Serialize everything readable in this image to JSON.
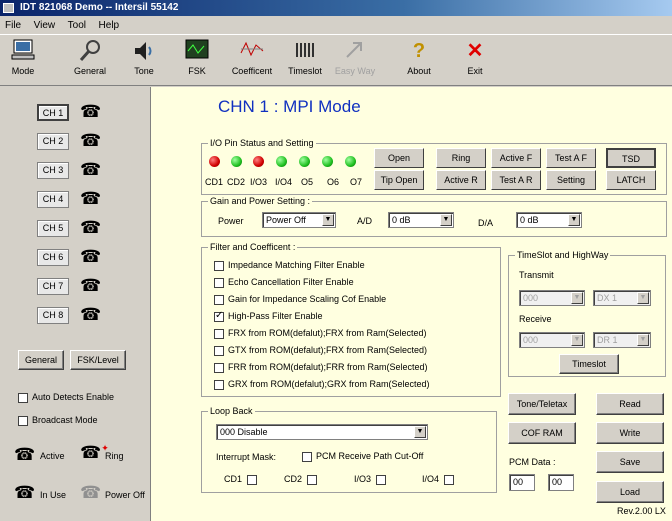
{
  "window": {
    "title": "IDT 821068 Demo -- Intersil 55142"
  },
  "menu": [
    "File",
    "View",
    "Tool",
    "Help"
  ],
  "toolbar": [
    {
      "label": "Mode",
      "icon": "computer-icon"
    },
    {
      "label": "General",
      "icon": "wrench-icon"
    },
    {
      "label": "Tone",
      "icon": "speaker-icon"
    },
    {
      "label": "FSK",
      "icon": "oscilloscope-icon"
    },
    {
      "label": "Coefficent",
      "icon": "waveform-icon"
    },
    {
      "label": "Timeslot",
      "icon": "timeslot-icon"
    },
    {
      "label": "Easy Way",
      "icon": "arrow-icon",
      "disabled": true
    },
    {
      "label": "About",
      "icon": "question-icon"
    },
    {
      "label": "Exit",
      "icon": "exit-x-icon"
    }
  ],
  "channels": [
    "CH 1",
    "CH 2",
    "CH 3",
    "CH 4",
    "CH 5",
    "CH 6",
    "CH 7",
    "CH 8"
  ],
  "left": {
    "general_button": "General",
    "fsk_button": "FSK/Level",
    "auto_detects": "Auto Detects Enable",
    "broadcast": "Broadcast Mode",
    "legend_active": "Active",
    "legend_ring": "Ring",
    "legend_inuse": "In Use",
    "legend_poweroff": "Power Off"
  },
  "main": {
    "title": "CHN 1 : MPI Mode",
    "io": {
      "group_title": "I/O Pin Status and Setting",
      "leds": [
        "red",
        "green",
        "red",
        "green",
        "green",
        "green",
        "green"
      ],
      "pins": [
        "CD1",
        "CD2",
        "I/O3",
        "I/O4",
        "O5",
        "O6",
        "O7"
      ],
      "buttons_row1": [
        "Open",
        "Ring",
        "Active F",
        "Test A F"
      ],
      "buttons_row2": [
        "Tip Open",
        "Active R",
        "Test A R",
        "Setting"
      ],
      "tsd": "TSD",
      "latch": "LATCH"
    },
    "gain": {
      "group_title": "Gain and Power Setting :",
      "power_label": "Power",
      "power_value": "Power Off",
      "ad_label": "A/D",
      "ad_value": "0 dB",
      "da_label": "D/A",
      "da_value": "0 dB"
    },
    "filter": {
      "group_title": "Filter and Coefficent :",
      "items": [
        {
          "label": "Impedance Matching Filter Enable",
          "checked": false
        },
        {
          "label": "Echo Cancellation Filter Enable",
          "checked": false
        },
        {
          "label": "Gain for Impedance Scaling Cof Enable",
          "checked": false
        },
        {
          "label": "High-Pass Filter Enable",
          "checked": true
        },
        {
          "label": "FRX from ROM(defalut);FRX from Ram(Selected)",
          "checked": false
        },
        {
          "label": "GTX from ROM(defalut);FRX from Ram(Selected)",
          "checked": false
        },
        {
          "label": "FRR from ROM(defalut);FRR from Ram(Selected)",
          "checked": false
        },
        {
          "label": "GRX from ROM(defalut);GRX from Ram(Selected)",
          "checked": false
        }
      ]
    },
    "timeslot": {
      "group_title": "TimeSlot and HighWay",
      "transmit_label": "Transmit",
      "transmit_slot": "000",
      "transmit_hw": "DX 1",
      "receive_label": "Receive",
      "receive_slot": "000",
      "receive_hw": "DR 1",
      "button": "Timeslot"
    },
    "loopback": {
      "group_title": "Loop Back",
      "value": "000 Disable",
      "interrupt_label": "Interrupt Mask:",
      "pcm_cutoff": "PCM Receive Path Cut-Off",
      "pins": [
        "CD1",
        "CD2",
        "I/O3",
        "I/O4"
      ]
    },
    "buttons": {
      "tone_teletax": "Tone/Teletax",
      "read": "Read",
      "cof_ram": "COF RAM",
      "write": "Write",
      "save": "Save",
      "load": "Load"
    },
    "pcm": {
      "label": "PCM Data :",
      "value1": "00",
      "value2": "00"
    },
    "version": "Rev.2.00 LX"
  }
}
